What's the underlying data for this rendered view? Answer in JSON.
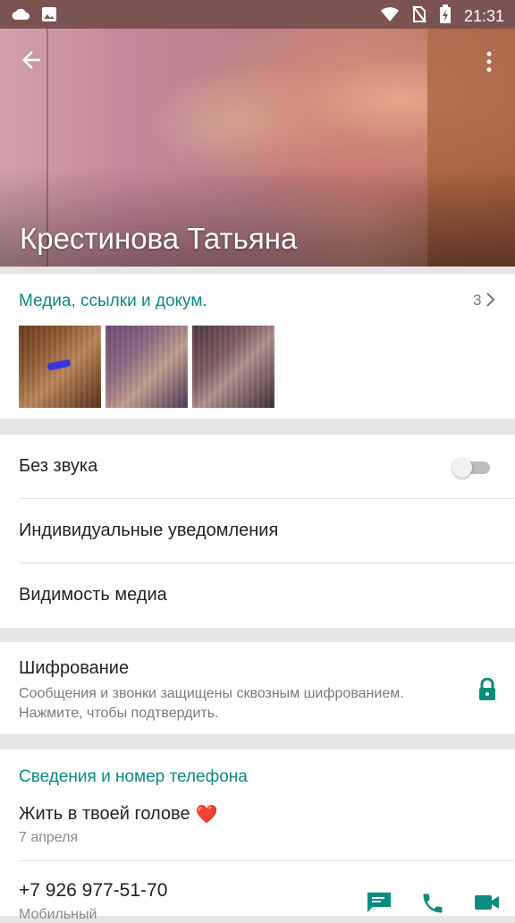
{
  "status_bar": {
    "time": "21:31",
    "icons": [
      "cloud-icon",
      "image-icon",
      "wifi-icon",
      "no-sim-icon",
      "battery-charging-icon"
    ]
  },
  "header": {
    "contact_name": "Крестинова Татьяна",
    "back_icon": "arrow-back-icon",
    "menu_icon": "more-vert-icon"
  },
  "media": {
    "title": "Медиа, ссылки и докум.",
    "count": "3",
    "thumbnails": [
      "photo-1",
      "photo-2",
      "photo-3"
    ]
  },
  "settings": {
    "mute_label": "Без звука",
    "mute_enabled": false,
    "custom_notifications_label": "Индивидуальные уведомления",
    "media_visibility_label": "Видимость медиа"
  },
  "encryption": {
    "title": "Шифрование",
    "description": "Сообщения и звонки защищены сквозным шифрованием. Нажмите, чтобы подтвердить.",
    "icon": "lock-icon"
  },
  "info": {
    "title": "Сведения и номер телефона",
    "status": "Жить в твоей голове",
    "status_emoji": "❤️",
    "status_date": "7 апреля",
    "phone": "+7 926 977-51-70",
    "phone_type": "Мобильный"
  },
  "colors": {
    "accent": "#078c7e",
    "status_bar": "#7b5350"
  }
}
